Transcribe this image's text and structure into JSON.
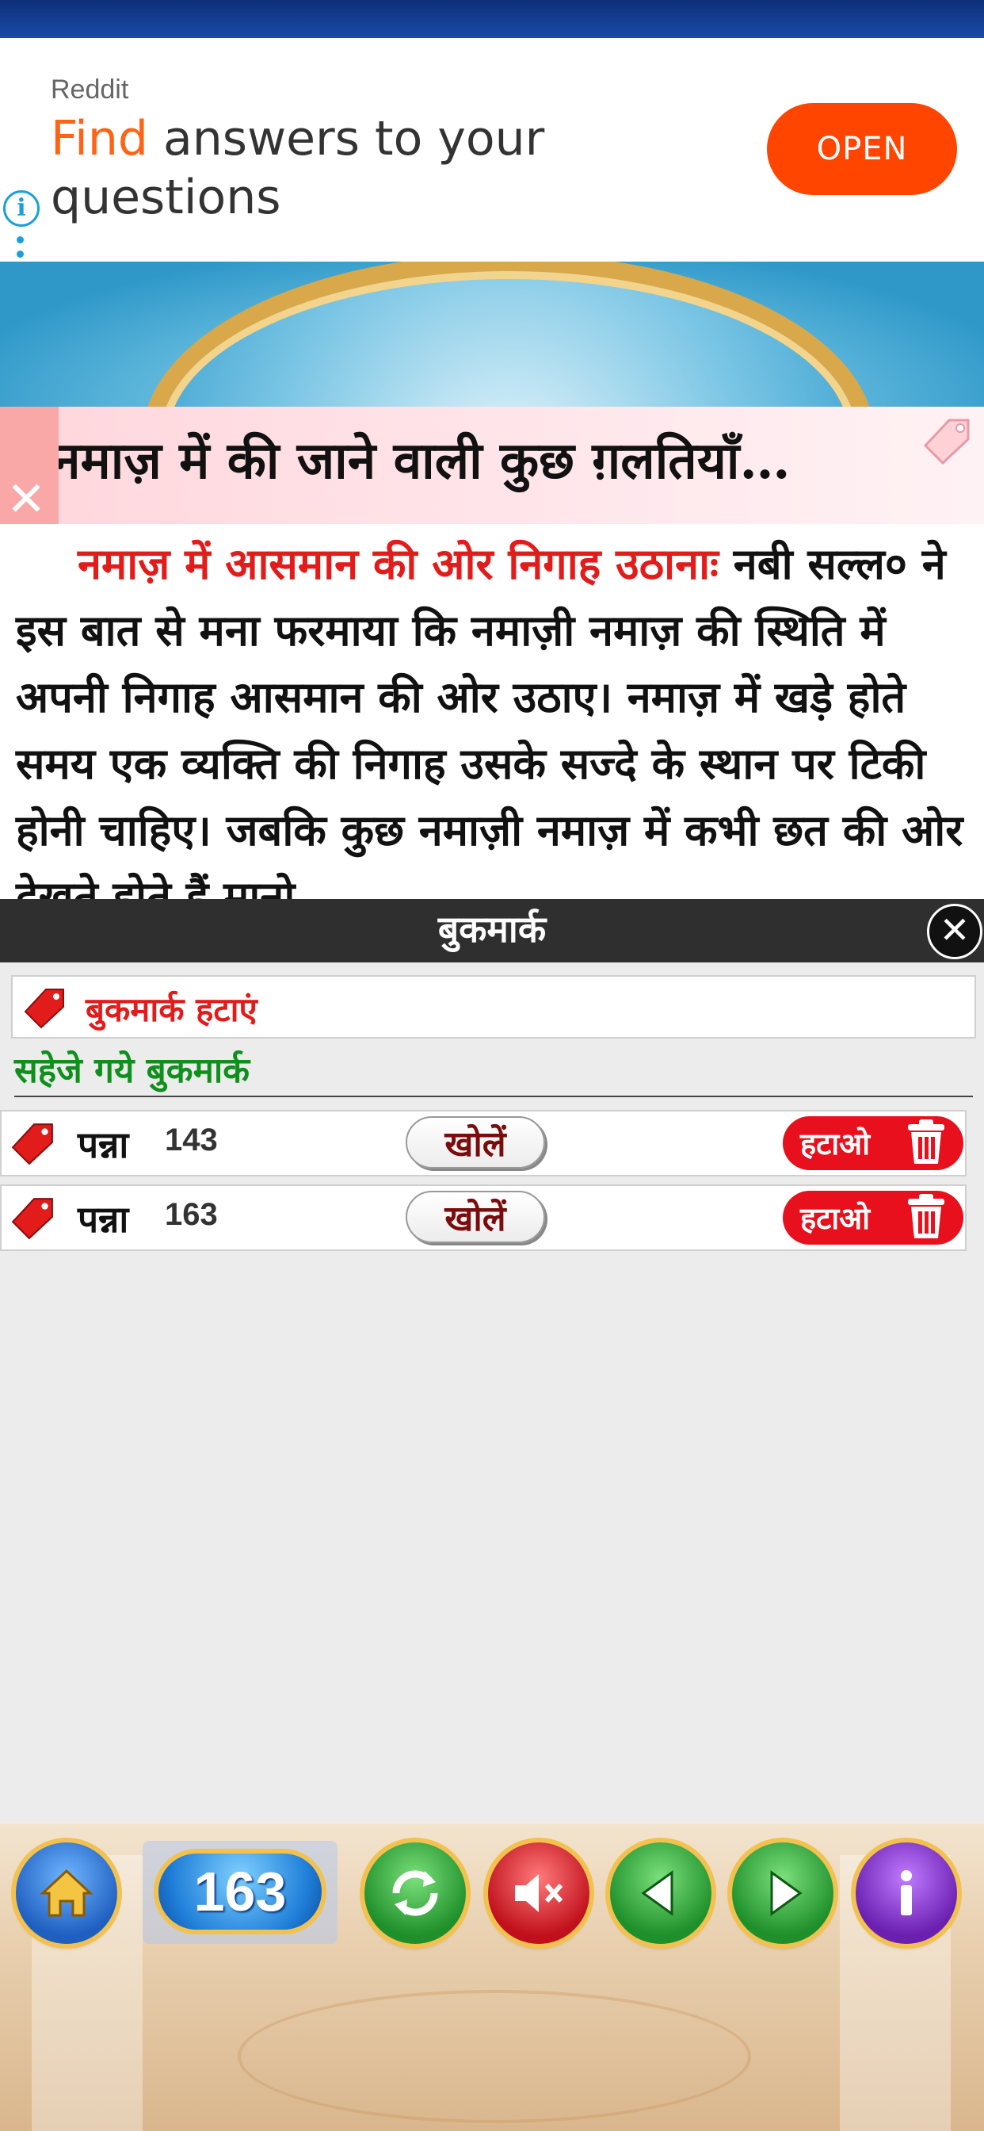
{
  "ad": {
    "brand": "Reddit",
    "headline_highlight": "Find",
    "headline_rest": " answers to your questions",
    "cta": "OPEN",
    "info_glyph": "i"
  },
  "article": {
    "title": "नमाज़ में की जाने वाली कुछ ग़लतियाँ…",
    "lead": "नमाज़ में आसमान की ओर निगाह उठानाः",
    "body": " नबी सल्ल० ने इस बात से मना फरमाया कि नमाज़ी नमाज़ की स्थिति में अपनी निगाह आसमान की ओर उठाए। नमाज़ में खड़े होते समय एक व्यक्ति की निगाह उसके सज्दे के स्थान पर टिकी होनी चाहिए। जबकि कुछ नमाज़ी नमाज़ में कभी छत की ओर देखते होते हैं मानो"
  },
  "bookmarks": {
    "header_title": "बुकमार्क",
    "remove_bookmark_label": "बुकमार्क हटाएं",
    "saved_heading": "सहेजे गये बुकमार्क",
    "items": [
      {
        "page_label": "पन्ना",
        "page_number": "143",
        "open_label": "खोलें",
        "delete_label": "हटाओ"
      },
      {
        "page_label": "पन्ना",
        "page_number": "163",
        "open_label": "खोलें",
        "delete_label": "हटाओ"
      }
    ]
  },
  "toolbar": {
    "current_page": "163",
    "icons": [
      "home-icon",
      "refresh-icon",
      "mute-icon",
      "previous-icon",
      "next-icon",
      "info-icon"
    ]
  },
  "colors": {
    "ad_accent": "#ff4500",
    "lead_red": "#e21b1b",
    "saved_green": "#0f8f1c",
    "delete_red": "#e8101c"
  }
}
